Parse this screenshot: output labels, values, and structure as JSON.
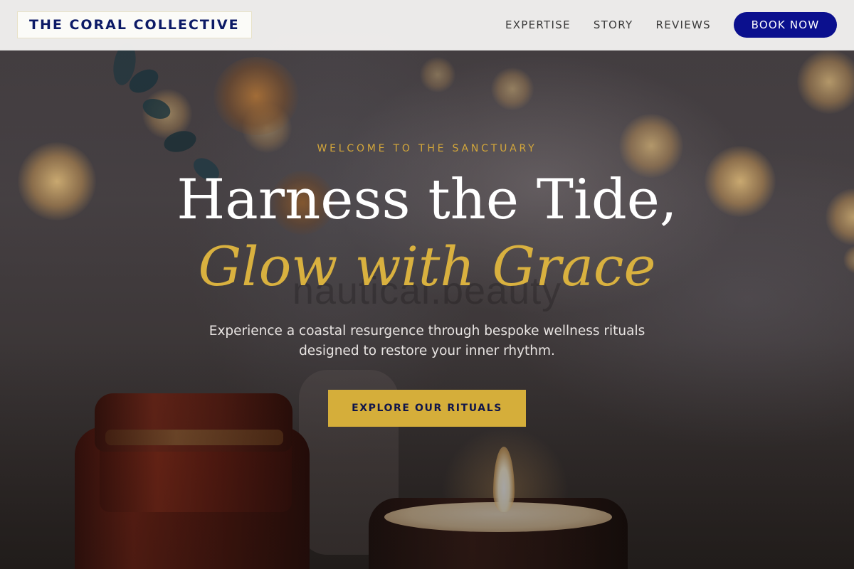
{
  "header": {
    "logo_text": "THE CORAL COLLECTIVE",
    "nav": {
      "expertise": "EXPERTISE",
      "story": "STORY",
      "reviews": "REVIEWS"
    },
    "book_button": "BOOK NOW"
  },
  "hero": {
    "eyebrow": "WELCOME TO THE SANCTUARY",
    "title_line1": "Harness the Tide,",
    "title_line2": "Glow with Grace",
    "background_watermark": "nautical.beauty",
    "subtitle_line1": "Experience a coastal resurgence through bespoke wellness rituals",
    "subtitle_line2": "designed to restore your inner rhythm.",
    "cta_label": "EXPLORE OUR RITUALS",
    "background_image": "blurred-candle-apothecary-jar-bokeh-photo"
  },
  "colors": {
    "navy": "#0b108e",
    "logo_navy": "#0c1a66",
    "gold": "#d5ae3a",
    "header_bg": "#f2f1f0",
    "white": "#ffffff"
  }
}
